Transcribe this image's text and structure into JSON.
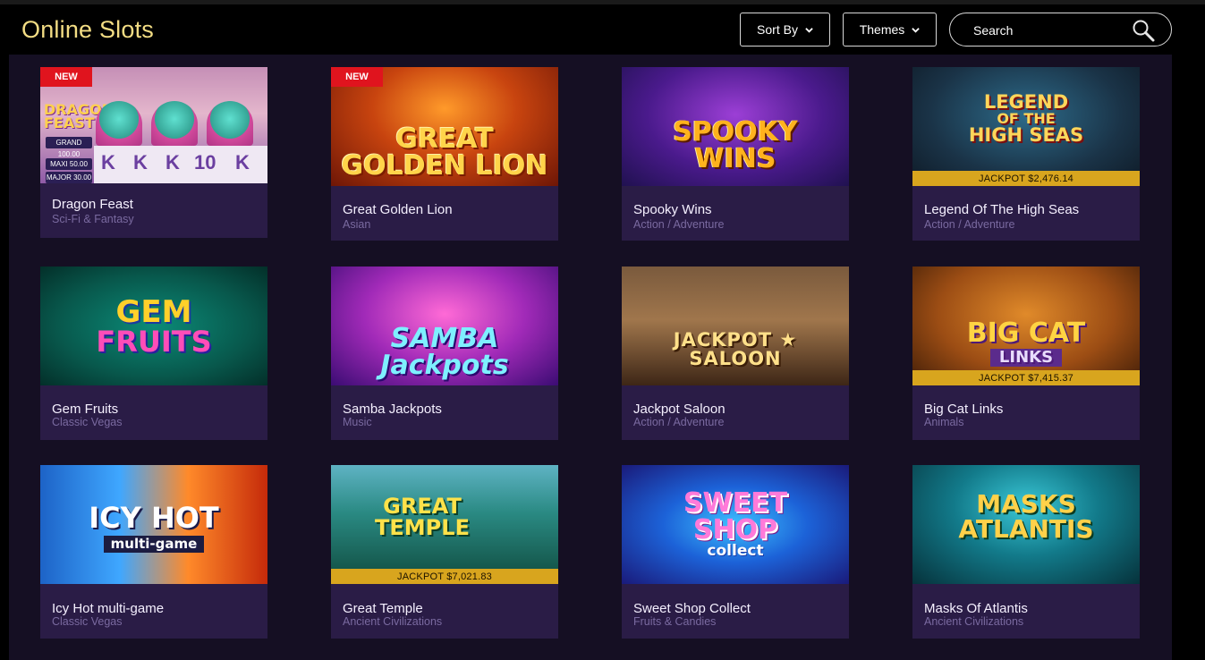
{
  "header": {
    "title": "Online Slots",
    "sort_label": "Sort By",
    "themes_label": "Themes",
    "search_placeholder": "Search"
  },
  "colors": {
    "title": "#f3dd84",
    "panel": "#150f23",
    "card": "#2a1c46",
    "category_text": "#7a6aa0",
    "new_badge": "#e0141e",
    "jackpot_bar": "#d8a51e"
  },
  "badge_new_label": "NEW",
  "games": [
    {
      "name": "Dragon Feast",
      "category": "Sci-Fi & Fantasy",
      "new": true,
      "jackpot": "",
      "thumb_text": [
        "DRAGON",
        "FEAST"
      ],
      "thumb_extra": {
        "grand": "GRAND",
        "grand_value": "100.00",
        "maxi": "MAXI",
        "maxi_value": "50.00",
        "major": "MAJOR",
        "major_value": "30.00",
        "reels": [
          "K",
          "K",
          "K",
          "10",
          "K"
        ]
      }
    },
    {
      "name": "Great Golden Lion",
      "category": "Asian",
      "new": true,
      "jackpot": "",
      "thumb_text": [
        "GREAT GOLDEN LION"
      ]
    },
    {
      "name": "Spooky Wins",
      "category": "Action / Adventure",
      "new": false,
      "jackpot": "",
      "thumb_text": [
        "SPOOKY WINS"
      ]
    },
    {
      "name": "Legend Of The High Seas",
      "category": "Action / Adventure",
      "new": false,
      "jackpot": "JACKPOT $2,476.14",
      "thumb_text": [
        "LEGEND",
        "OF THE",
        "HIGH SEAS"
      ]
    },
    {
      "name": "Gem Fruits",
      "category": "Classic Vegas",
      "new": false,
      "jackpot": "",
      "thumb_text": [
        "GEM",
        "FRUITS"
      ]
    },
    {
      "name": "Samba Jackpots",
      "category": "Music",
      "new": false,
      "jackpot": "",
      "thumb_text": [
        "SAMBA Jackpots"
      ]
    },
    {
      "name": "Jackpot Saloon",
      "category": "Action / Adventure",
      "new": false,
      "jackpot": "",
      "thumb_text": [
        "JACKPOT ★ SALOON"
      ]
    },
    {
      "name": "Big Cat Links",
      "category": "Animals",
      "new": false,
      "jackpot": "JACKPOT $7,415.37",
      "thumb_text": [
        "BIG CAT",
        "LINKS"
      ]
    },
    {
      "name": "Icy Hot multi-game",
      "category": "Classic Vegas",
      "new": false,
      "jackpot": "",
      "thumb_text": [
        "ICY HOT",
        "multi-game"
      ]
    },
    {
      "name": "Great Temple",
      "category": "Ancient Civilizations",
      "new": false,
      "jackpot": "JACKPOT $7,021.83",
      "thumb_text": [
        "GREAT",
        "TEMPLE"
      ]
    },
    {
      "name": "Sweet Shop Collect",
      "category": "Fruits & Candies",
      "new": false,
      "jackpot": "",
      "thumb_text": [
        "SWEET",
        "SHOP",
        "collect"
      ]
    },
    {
      "name": "Masks Of Atlantis",
      "category": "Ancient Civilizations",
      "new": false,
      "jackpot": "",
      "thumb_text": [
        "MASKS",
        "ATLANTIS"
      ]
    }
  ]
}
